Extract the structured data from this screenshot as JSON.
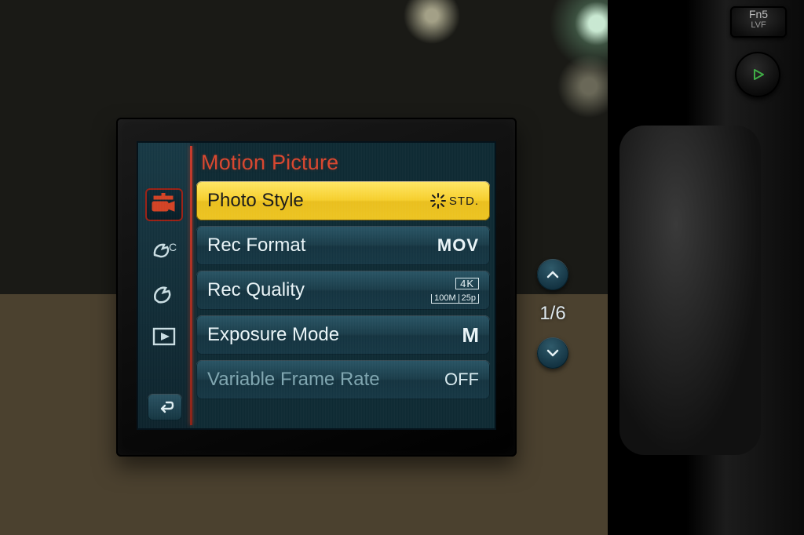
{
  "camera_body": {
    "fn_button_label": "Fn5",
    "fn_button_sub": "LVF",
    "play_button": "play-icon"
  },
  "menu": {
    "title": "Motion Picture",
    "page_current": 1,
    "page_total": 6,
    "page_display": "1/6",
    "tabs": [
      {
        "id": "motion-picture",
        "icon": "video-camera-icon",
        "selected": true
      },
      {
        "id": "custom",
        "icon": "wrench-c-icon",
        "selected": false
      },
      {
        "id": "setup",
        "icon": "wrench-icon",
        "selected": false
      },
      {
        "id": "playback",
        "icon": "play-rect-icon",
        "selected": false
      }
    ],
    "items": [
      {
        "label": "Photo Style",
        "value": "STD.",
        "value_kind": "std",
        "selected": true,
        "disabled": false
      },
      {
        "label": "Rec Format",
        "value": "MOV",
        "value_kind": "text",
        "selected": false,
        "disabled": false
      },
      {
        "label": "Rec Quality",
        "value": "4K 100M 25p",
        "value_kind": "recq",
        "recq": {
          "top": "4K",
          "bl": "100M",
          "br": "25p"
        },
        "selected": false,
        "disabled": false
      },
      {
        "label": "Exposure Mode",
        "value": "M",
        "value_kind": "m",
        "selected": false,
        "disabled": false
      },
      {
        "label": "Variable Frame Rate",
        "value": "OFF",
        "value_kind": "off",
        "selected": false,
        "disabled": true
      }
    ],
    "back_label": "back"
  }
}
